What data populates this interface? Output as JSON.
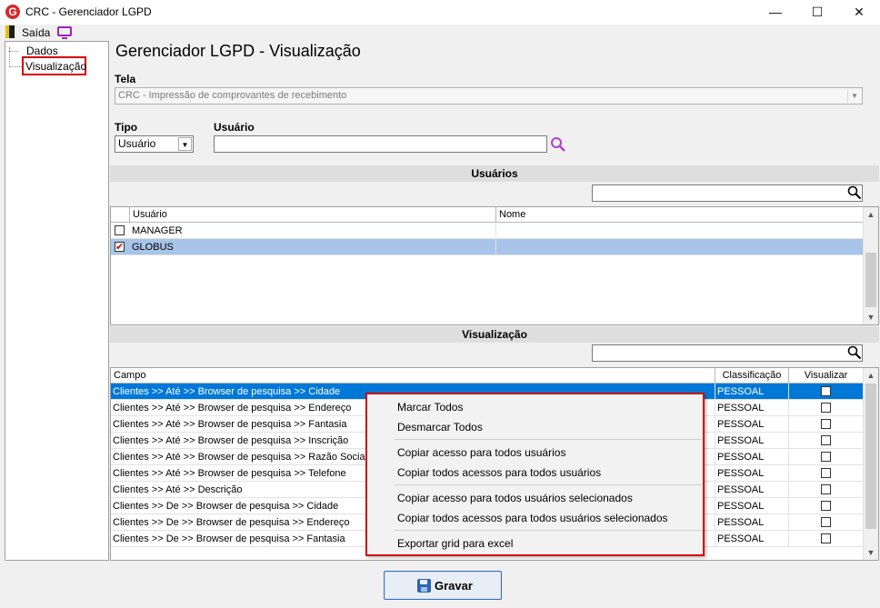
{
  "window": {
    "logo_letter": "G",
    "title": "CRC - Gerenciador LGPD",
    "minimize_glyph": "—",
    "maximize_glyph": "☐",
    "close_glyph": "✕"
  },
  "toolbar": {
    "exit_label": "Saída"
  },
  "tree": {
    "items": [
      "Dados",
      "Visualização"
    ],
    "selected": "Visualização"
  },
  "page": {
    "title": "Gerenciador LGPD - Visualização"
  },
  "form": {
    "tela_label": "Tela",
    "tela_value": "CRC - Impressão de comprovantes de recebimento",
    "tipo_label": "Tipo",
    "tipo_value": "Usuário",
    "usuario_label": "Usuário",
    "usuario_value": ""
  },
  "users_section": {
    "header": "Usuários",
    "columns": [
      "Usuário",
      "Nome"
    ],
    "rows": [
      {
        "usuario": "MANAGER",
        "nome": "",
        "checked": false
      },
      {
        "usuario": "GLOBUS",
        "nome": "",
        "checked": true
      }
    ]
  },
  "view_section": {
    "header": "Visualização",
    "columns": [
      "Campo",
      "Classificação",
      "Visualizar"
    ],
    "rows": [
      {
        "campo": "Clientes >> Até >> Browser de pesquisa >> Cidade",
        "classificacao": "PESSOAL",
        "visualizar": false
      },
      {
        "campo": "Clientes >> Até >> Browser de pesquisa >> Endereço",
        "classificacao": "PESSOAL",
        "visualizar": false
      },
      {
        "campo": "Clientes >> Até >> Browser de pesquisa >> Fantasia",
        "classificacao": "PESSOAL",
        "visualizar": false
      },
      {
        "campo": "Clientes >> Até >> Browser de pesquisa >> Inscrição",
        "classificacao": "PESSOAL",
        "visualizar": false
      },
      {
        "campo": "Clientes >> Até >> Browser de pesquisa >> Razão Social",
        "classificacao": "PESSOAL",
        "visualizar": false
      },
      {
        "campo": "Clientes >> Até >> Browser de pesquisa >> Telefone",
        "classificacao": "PESSOAL",
        "visualizar": false
      },
      {
        "campo": "Clientes >> Até >> Descrição",
        "classificacao": "PESSOAL",
        "visualizar": false
      },
      {
        "campo": "Clientes >> De >> Browser de pesquisa >> Cidade",
        "classificacao": "PESSOAL",
        "visualizar": false
      },
      {
        "campo": "Clientes >> De >> Browser de pesquisa >> Endereço",
        "classificacao": "PESSOAL",
        "visualizar": false
      },
      {
        "campo": "Clientes >> De >> Browser de pesquisa >> Fantasia",
        "classificacao": "PESSOAL",
        "visualizar": false
      }
    ]
  },
  "context_menu": {
    "groups": [
      [
        "Marcar Todos",
        "Desmarcar Todos"
      ],
      [
        "Copiar acesso para todos usuários",
        "Copiar todos acessos para todos usuários"
      ],
      [
        "Copiar acesso para todos usuários selecionados",
        "Copiar todos acessos para todos usuários selecionados"
      ],
      [
        "Exportar grid para excel"
      ]
    ]
  },
  "footer": {
    "save_label": "Gravar"
  },
  "colors": {
    "selection": "#0078d7",
    "selected_row": "#a8c4e8",
    "highlight_border": "#d40000",
    "purple_icon": "#a020c0"
  }
}
